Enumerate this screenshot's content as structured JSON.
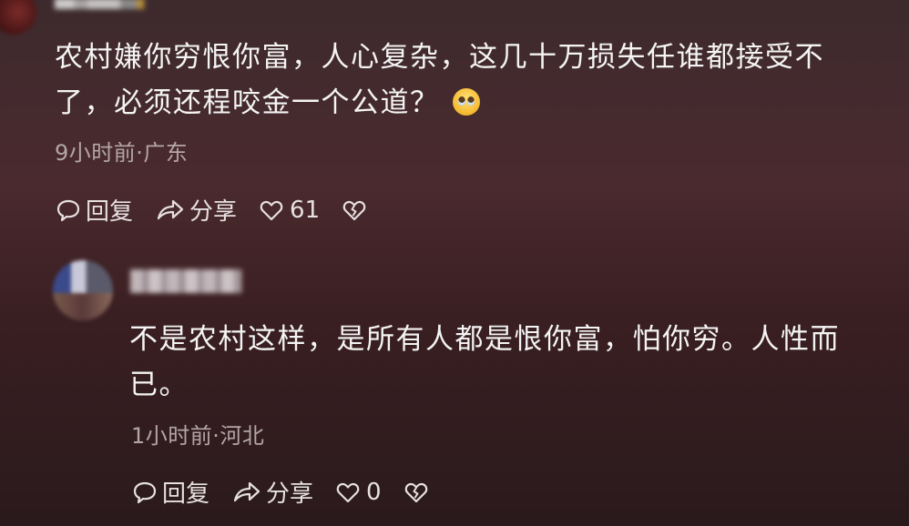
{
  "comments": [
    {
      "text_line1": "农村嫌你穷恨你富，人心复杂，这几十万损失任谁都接受不",
      "text_line2": "了，必须还程咬金一个公道？",
      "emoji": "crying-face-emoji",
      "meta": "9小时前·广东",
      "reply_label": "回复",
      "share_label": "分享",
      "like_count": "61"
    },
    {
      "text_line1": "不是农村这样，是所有人都是恨你富，怕你穷。人性而",
      "text_line2": "已。",
      "meta": "1小时前·河北",
      "reply_label": "回复",
      "share_label": "分享",
      "like_count": "0"
    }
  ],
  "colors": {
    "text": "#f4f4f4",
    "meta": "#b3a6a8",
    "background_top": "#3d2a2d",
    "background_bottom": "#2a1a1c"
  }
}
